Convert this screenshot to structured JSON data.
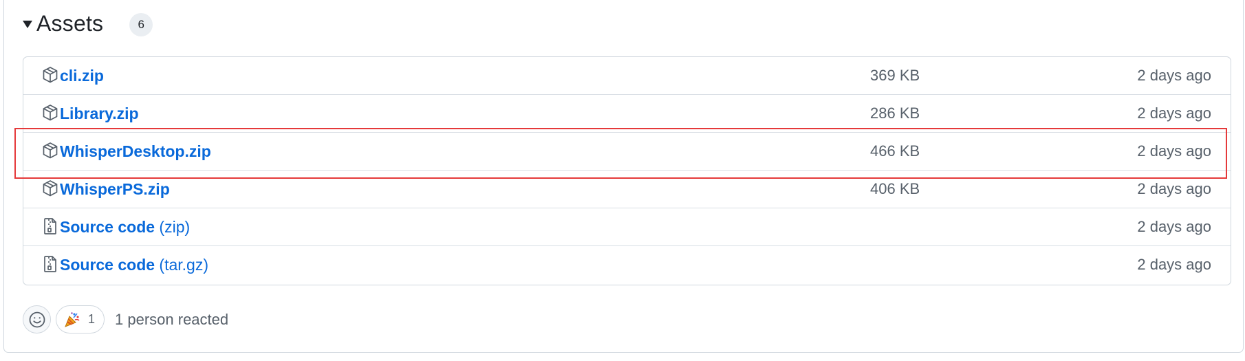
{
  "assets_section": {
    "title": "Assets",
    "count": "6",
    "items": [
      {
        "name": "cli.zip",
        "suffix": "",
        "size": "369 KB",
        "date": "2 days ago",
        "icon": "package-icon"
      },
      {
        "name": "Library.zip",
        "suffix": "",
        "size": "286 KB",
        "date": "2 days ago",
        "icon": "package-icon"
      },
      {
        "name": "WhisperDesktop.zip",
        "suffix": "",
        "size": "466 KB",
        "date": "2 days ago",
        "icon": "package-icon",
        "highlighted": true
      },
      {
        "name": "WhisperPS.zip",
        "suffix": "",
        "size": "406 KB",
        "date": "2 days ago",
        "icon": "package-icon"
      },
      {
        "name": "Source code",
        "suffix": " (zip)",
        "size": "",
        "date": "2 days ago",
        "icon": "file-zip-icon"
      },
      {
        "name": "Source code",
        "suffix": " (tar.gz)",
        "size": "",
        "date": "2 days ago",
        "icon": "file-zip-icon"
      }
    ]
  },
  "reactions": {
    "add_reaction_icon": "smiley-icon",
    "items": [
      {
        "emoji": "party-popper-icon",
        "count": "1"
      }
    ],
    "summary": "1 person reacted"
  },
  "colors": {
    "link": "#0969da",
    "muted": "#57606a",
    "border": "#d0d7de",
    "highlight": "#e5393a"
  }
}
